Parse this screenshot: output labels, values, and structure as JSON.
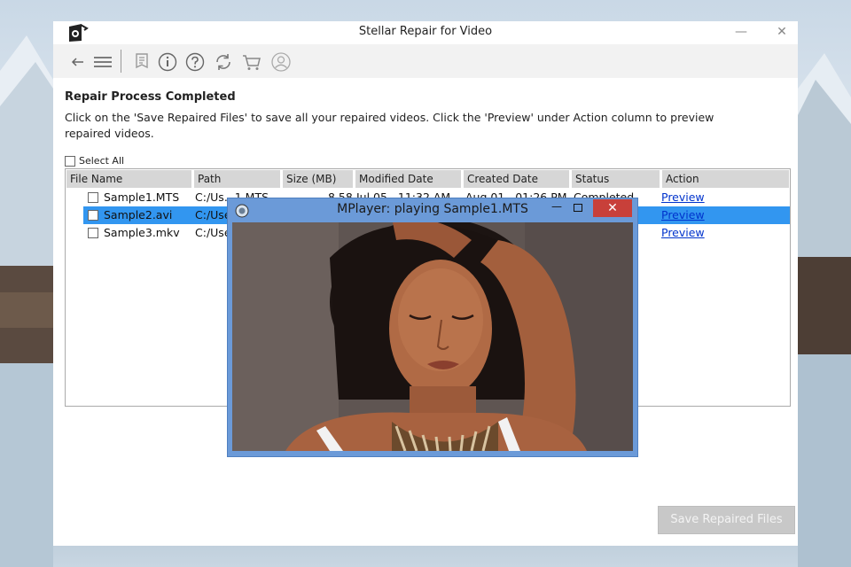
{
  "window": {
    "title": "Stellar Repair for Video",
    "minimize_glyph": "—",
    "close_glyph": "✕"
  },
  "toolbar": {
    "icons": [
      "back-arrow-icon",
      "menu-icon",
      "save-report-icon",
      "info-icon",
      "help-icon",
      "refresh-icon",
      "cart-icon",
      "account-icon"
    ]
  },
  "main": {
    "heading": "Repair Process Completed",
    "description": "Click on the 'Save Repaired Files' to save all your repaired videos. Click the 'Preview' under Action column to preview repaired videos.",
    "select_all_label": "Select All"
  },
  "table": {
    "columns": [
      "File Name",
      "Path",
      "Size (MB)",
      "Modified Date",
      "Created Date",
      "Status",
      "Action"
    ],
    "rows": [
      {
        "name": "Sample1.MTS",
        "path": "C:/Us...1.MTS",
        "size": "8.58",
        "modified": "Jul 05...11:32 AM",
        "created": "Aug 01...01:26 PM",
        "status": "Completed",
        "action": "Preview",
        "selected": false
      },
      {
        "name": "Sample2.avi",
        "path": "C:/Use",
        "size": "",
        "modified": "",
        "created": "",
        "status": "",
        "action": "Preview",
        "selected": true
      },
      {
        "name": "Sample3.mkv",
        "path": "C:/Use",
        "size": "",
        "modified": "",
        "created": "",
        "status": "",
        "action": "Preview",
        "selected": false
      }
    ]
  },
  "save_button": {
    "label": "Save Repaired Files",
    "enabled": false
  },
  "mplayer": {
    "title": "MPlayer: playing Sample1.MTS",
    "close_glyph": "✕",
    "minimize_glyph": "—"
  },
  "colors": {
    "selection": "#3296f0",
    "link": "#0033cc",
    "mplayer_frame": "#6b9ad8",
    "mplayer_close": "#c8403a"
  }
}
